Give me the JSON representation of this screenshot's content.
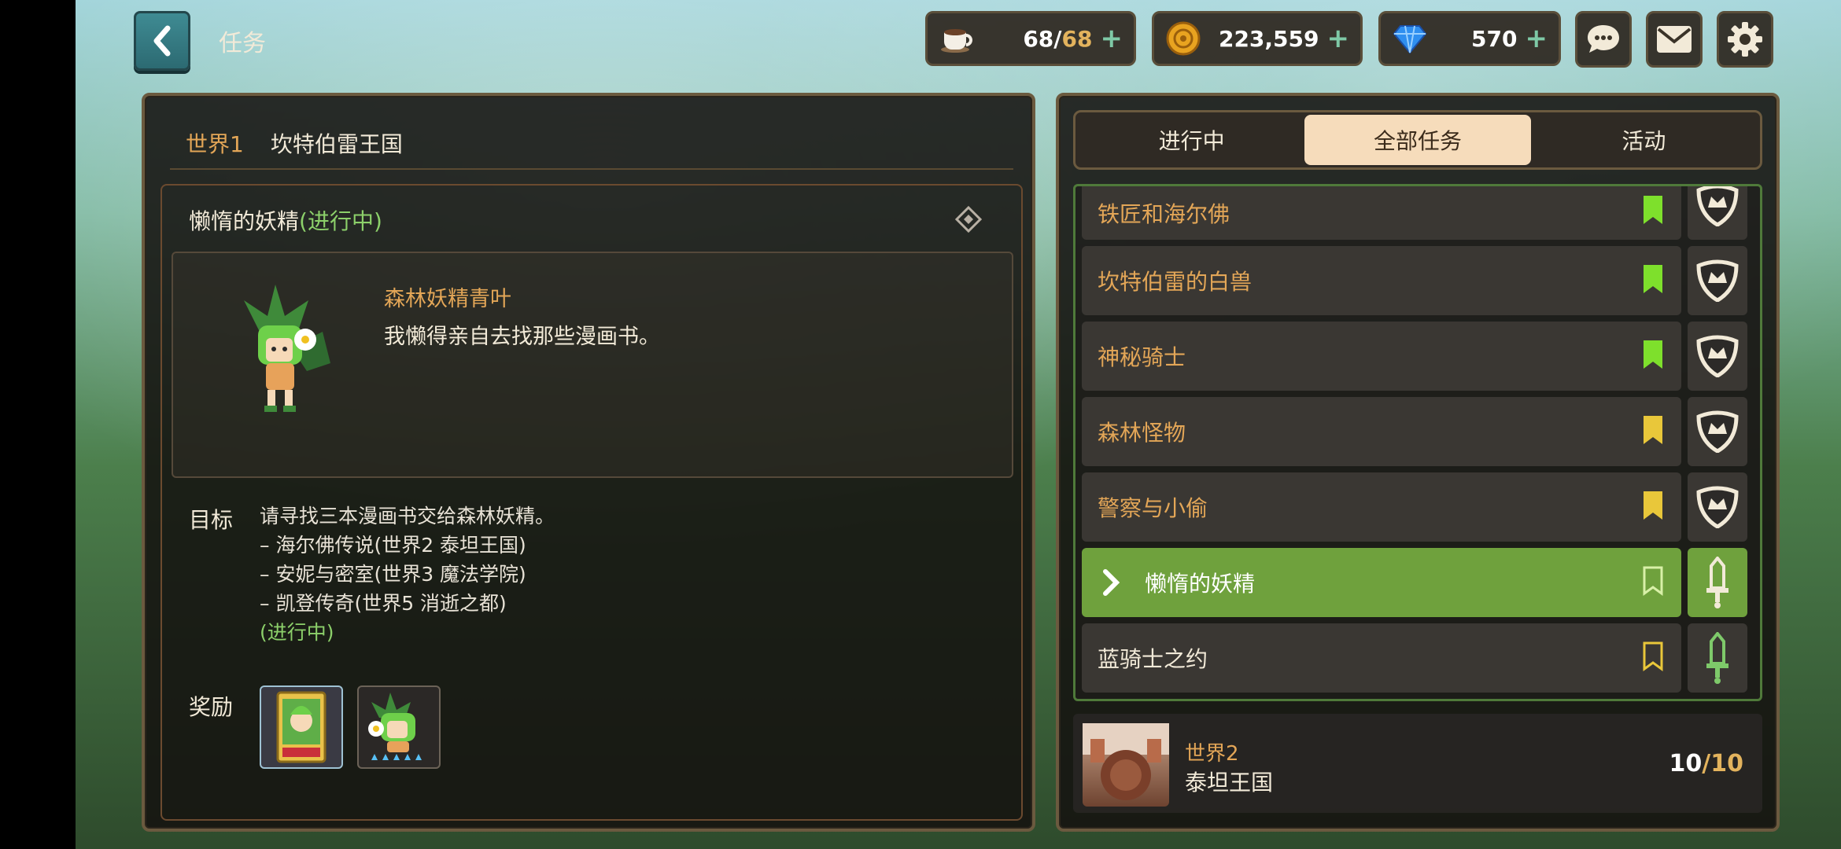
{
  "header": {
    "title": "任务",
    "resources": [
      {
        "icon": "coffee-cup-icon",
        "value": "68",
        "cap": "68"
      },
      {
        "icon": "gold-coin-icon",
        "value": "223,559"
      },
      {
        "icon": "blue-gem-icon",
        "value": "570"
      }
    ],
    "plus_symbol": "+",
    "slash": "/"
  },
  "left": {
    "world": "世界1",
    "kingdom": "坎特伯雷王国",
    "quest_title": "懒惰的妖精",
    "quest_status": "(进行中)",
    "npc_name": "森林妖精青叶",
    "npc_line": "我懒得亲自去找那些漫画书。",
    "goal_label": "目标",
    "goal_lines": [
      "请寻找三本漫画书交给森林妖精。",
      "– 海尔佛传说(世界2  泰坦王国)",
      "– 安妮与密室(世界3  魔法学院)",
      "– 凯登传奇(世界5  消逝之都)"
    ],
    "goal_status": "(进行中)",
    "reward_label": "奖励"
  },
  "right": {
    "tabs": [
      "进行中",
      "全部任务",
      "活动"
    ],
    "active_tab": "全部任务",
    "quests": [
      {
        "name": "铁匠和海尔佛",
        "mark": "green",
        "emblem": "crown-shield-icon"
      },
      {
        "name": "坎特伯雷的白兽",
        "mark": "green",
        "emblem": "crown-shield-icon"
      },
      {
        "name": "神秘骑士",
        "mark": "green",
        "emblem": "crown-shield-icon"
      },
      {
        "name": "森林怪物",
        "mark": "yellow",
        "emblem": "crown-shield-icon"
      },
      {
        "name": "警察与小偷",
        "mark": "yellow",
        "emblem": "crown-shield-icon"
      },
      {
        "name": "懒惰的妖精",
        "mark": "outline-light",
        "emblem": "sword-icon",
        "active": true
      },
      {
        "name": "蓝骑士之约",
        "mark": "outline-yellow",
        "emblem": "sword-icon"
      }
    ],
    "world_card": {
      "world": "世界2",
      "name": "泰坦王国",
      "done": "10",
      "total": "10"
    }
  },
  "colors": {
    "accent_orange": "#e3a657",
    "progress_green": "#8cd06a",
    "active_row": "#6fa13d",
    "mark_green": "#7ee02c",
    "mark_yellow": "#e9c73a"
  }
}
